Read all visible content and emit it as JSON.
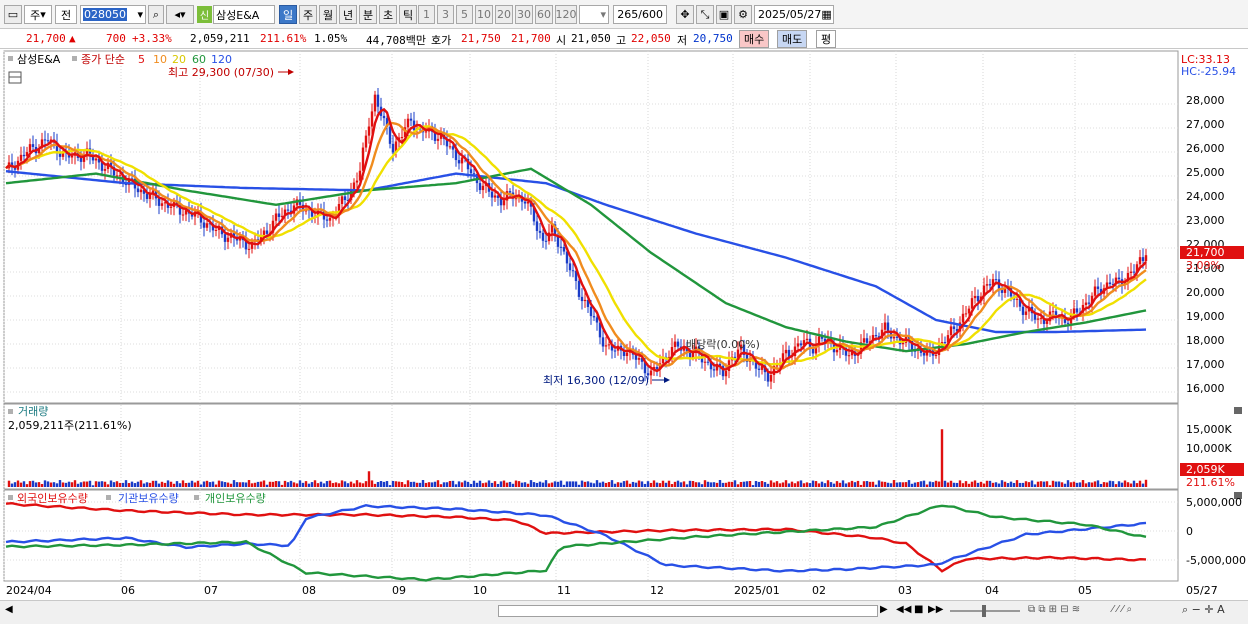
{
  "toolbar": {
    "period_unit": "주",
    "prev_label": "전",
    "stock_code": "028050",
    "badge": "신",
    "stock_name": "삼성E&A",
    "periods": [
      "일",
      "주",
      "월",
      "년",
      "분",
      "초",
      "틱"
    ],
    "numbers": [
      "1",
      "3",
      "5",
      "10",
      "20",
      "30",
      "60",
      "120"
    ],
    "count": "265",
    "count_total": "/600",
    "date": "2025/05/27"
  },
  "info": {
    "price": "21,700",
    "change": "700",
    "change_pct": "+3.33%",
    "volume": "2,059,211",
    "volume_ratio": "211.61%",
    "turnover": "1.05%",
    "amount": "44,708백만",
    "hoga_label": "호가",
    "ask": "21,750",
    "bid": "21,700",
    "open_label": "시",
    "open": "21,050",
    "high_label": "고",
    "high": "22,050",
    "low_label": "저",
    "low": "20,750",
    "buy_label": "매수",
    "sell_label": "매도",
    "avg_label": "평"
  },
  "price_panel": {
    "legend_name": "삼성E&A",
    "legend_ma": "종가 단순",
    "ma_periods": [
      "5",
      "10",
      "20",
      "60",
      "120"
    ],
    "ma_colors": [
      "#e01010",
      "#f08c1e",
      "#f0e000",
      "#21963c",
      "#2850e6"
    ],
    "lc": "LC:33.13",
    "hc": "HC:-25.94",
    "high_note": "최고 29,300 (07/30)",
    "low_note": "최저 16,300 (12/09)",
    "dividend_note": "배당락(0.00%)",
    "current_price_label": "21,700",
    "current_pct_label": "3.09%",
    "y_ticks": [
      "28,000",
      "27,000",
      "26,000",
      "25,000",
      "24,000",
      "23,000",
      "22,000",
      "21,000",
      "20,000",
      "19,000",
      "18,000",
      "17,000",
      "16,000"
    ]
  },
  "volume_panel": {
    "title": "거래량",
    "value_label": "2,059,211주(211.61%)",
    "y_ticks": [
      "15,000K",
      "10,000K"
    ],
    "current_label": "2,059K",
    "current_pct": "211.61%"
  },
  "holding_panel": {
    "series": [
      "외국인보유수량",
      "기관보유수량",
      "개인보유수량"
    ],
    "series_colors": [
      "#e01010",
      "#2850e6",
      "#21963c"
    ],
    "y_ticks": [
      "5,000,000",
      "0",
      "-5,000,000"
    ]
  },
  "x_axis": {
    "labels": [
      "2024/04",
      "06",
      "07",
      "08",
      "09",
      "10",
      "11",
      "12",
      "2025/01",
      "02",
      "03",
      "04",
      "05"
    ],
    "last": "05/27"
  },
  "chart_data": {
    "type": "candlestick",
    "title": "삼성E&A",
    "x_range": [
      "2024/04",
      "2025/05/27"
    ],
    "price_ylim": [
      15500,
      29300
    ],
    "price_path": [
      [
        0,
        25200
      ],
      [
        8,
        26100
      ],
      [
        14,
        26500
      ],
      [
        20,
        25800
      ],
      [
        27,
        25900
      ],
      [
        34,
        25300
      ],
      [
        40,
        24800
      ],
      [
        46,
        24300
      ],
      [
        52,
        23900
      ],
      [
        58,
        23600
      ],
      [
        64,
        23300
      ],
      [
        70,
        22700
      ],
      [
        76,
        22400
      ],
      [
        82,
        22100
      ],
      [
        86,
        22600
      ],
      [
        90,
        23200
      ],
      [
        96,
        23800
      ],
      [
        102,
        23500
      ],
      [
        108,
        23200
      ],
      [
        114,
        24200
      ],
      [
        118,
        25200
      ],
      [
        121,
        27300
      ],
      [
        123,
        28300
      ],
      [
        126,
        27200
      ],
      [
        129,
        26200
      ],
      [
        132,
        26700
      ],
      [
        135,
        27400
      ],
      [
        138,
        26800
      ],
      [
        141,
        26900
      ],
      [
        145,
        26600
      ],
      [
        149,
        26000
      ],
      [
        153,
        25500
      ],
      [
        157,
        24800
      ],
      [
        161,
        24300
      ],
      [
        165,
        24000
      ],
      [
        169,
        24200
      ],
      [
        173,
        24000
      ],
      [
        176,
        23200
      ],
      [
        179,
        22300
      ],
      [
        182,
        22700
      ],
      [
        185,
        22100
      ],
      [
        188,
        21100
      ],
      [
        191,
        20200
      ],
      [
        194,
        19500
      ],
      [
        197,
        18700
      ],
      [
        200,
        17900
      ],
      [
        203,
        17700
      ],
      [
        206,
        17800
      ],
      [
        209,
        17500
      ],
      [
        212,
        17200
      ],
      [
        215,
        16700
      ],
      [
        218,
        17200
      ],
      [
        221,
        17700
      ],
      [
        224,
        17900
      ],
      [
        227,
        17700
      ],
      [
        230,
        17600
      ],
      [
        233,
        17300
      ],
      [
        236,
        17000
      ],
      [
        239,
        16800
      ],
      [
        242,
        17500
      ],
      [
        245,
        17700
      ],
      [
        248,
        17400
      ],
      [
        251,
        16900
      ],
      [
        254,
        16700
      ],
      [
        257,
        17100
      ],
      [
        260,
        17600
      ],
      [
        263,
        17800
      ],
      [
        266,
        18100
      ],
      [
        269,
        17900
      ],
      [
        272,
        18200
      ],
      [
        275,
        18000
      ],
      [
        278,
        17800
      ],
      [
        281,
        17500
      ],
      [
        284,
        17800
      ],
      [
        287,
        18100
      ],
      [
        290,
        18400
      ],
      [
        293,
        18600
      ],
      [
        296,
        18300
      ],
      [
        299,
        18100
      ],
      [
        302,
        17900
      ],
      [
        305,
        17700
      ],
      [
        308,
        17500
      ],
      [
        311,
        17900
      ],
      [
        314,
        18300
      ],
      [
        317,
        18800
      ],
      [
        320,
        19300
      ],
      [
        323,
        19900
      ],
      [
        326,
        20300
      ],
      [
        329,
        20600
      ],
      [
        332,
        20400
      ],
      [
        335,
        20000
      ],
      [
        338,
        19600
      ],
      [
        341,
        19300
      ],
      [
        344,
        19000
      ],
      [
        347,
        19100
      ],
      [
        350,
        19200
      ],
      [
        353,
        19000
      ],
      [
        356,
        19200
      ],
      [
        359,
        19600
      ],
      [
        362,
        20000
      ],
      [
        365,
        20300
      ],
      [
        368,
        20600
      ],
      [
        371,
        20500
      ],
      [
        374,
        20900
      ],
      [
        377,
        21200
      ],
      [
        380,
        21700
      ]
    ],
    "ma120_path": [
      [
        0,
        25200
      ],
      [
        40,
        24700
      ],
      [
        80,
        24500
      ],
      [
        120,
        24400
      ],
      [
        150,
        25100
      ],
      [
        180,
        24700
      ],
      [
        200,
        23800
      ],
      [
        230,
        22600
      ],
      [
        260,
        21600
      ],
      [
        290,
        20400
      ],
      [
        310,
        19000
      ],
      [
        330,
        18500
      ],
      [
        350,
        18500
      ],
      [
        380,
        18600
      ]
    ],
    "ma60_path": [
      [
        0,
        24700
      ],
      [
        30,
        25100
      ],
      [
        60,
        24400
      ],
      [
        90,
        23800
      ],
      [
        120,
        24400
      ],
      [
        150,
        24700
      ],
      [
        175,
        25300
      ],
      [
        195,
        23800
      ],
      [
        215,
        21800
      ],
      [
        240,
        19700
      ],
      [
        260,
        18700
      ],
      [
        280,
        18100
      ],
      [
        300,
        17700
      ],
      [
        320,
        18000
      ],
      [
        340,
        18500
      ],
      [
        360,
        18900
      ],
      [
        380,
        19400
      ]
    ],
    "volume_spikes": [
      {
        "date": "2024/07/30",
        "value_k": 4500
      },
      {
        "date": "2025/02/28",
        "value_k": 16500
      },
      {
        "date": "2025/05/27",
        "value_k": 2059
      }
    ],
    "holding_foreign_path": [
      [
        0,
        4700
      ],
      [
        40,
        3500
      ],
      [
        80,
        2800
      ],
      [
        120,
        2800
      ],
      [
        150,
        2400
      ],
      [
        170,
        1800
      ],
      [
        180,
        -400
      ],
      [
        220,
        100
      ],
      [
        260,
        300
      ],
      [
        290,
        -1200
      ],
      [
        300,
        -2200
      ],
      [
        312,
        -6800
      ],
      [
        320,
        -4800
      ],
      [
        350,
        -4600
      ],
      [
        380,
        -5000
      ]
    ],
    "holding_inst_path": [
      [
        0,
        -1900
      ],
      [
        40,
        -1200
      ],
      [
        60,
        -2800
      ],
      [
        80,
        -2200
      ],
      [
        95,
        -2500
      ],
      [
        100,
        2200
      ],
      [
        120,
        4300
      ],
      [
        150,
        3800
      ],
      [
        180,
        2700
      ],
      [
        200,
        -800
      ],
      [
        220,
        -5900
      ],
      [
        260,
        -6900
      ],
      [
        280,
        -6600
      ],
      [
        310,
        -5800
      ],
      [
        340,
        -600
      ],
      [
        380,
        1300
      ]
    ],
    "holding_indiv_path": [
      [
        0,
        -2700
      ],
      [
        40,
        -2400
      ],
      [
        80,
        -1900
      ],
      [
        100,
        -7200
      ],
      [
        140,
        -8400
      ],
      [
        180,
        -6800
      ],
      [
        185,
        -2700
      ],
      [
        230,
        -1000
      ],
      [
        290,
        700
      ],
      [
        312,
        4500
      ],
      [
        330,
        2400
      ],
      [
        360,
        1100
      ],
      [
        380,
        -1100
      ]
    ]
  }
}
